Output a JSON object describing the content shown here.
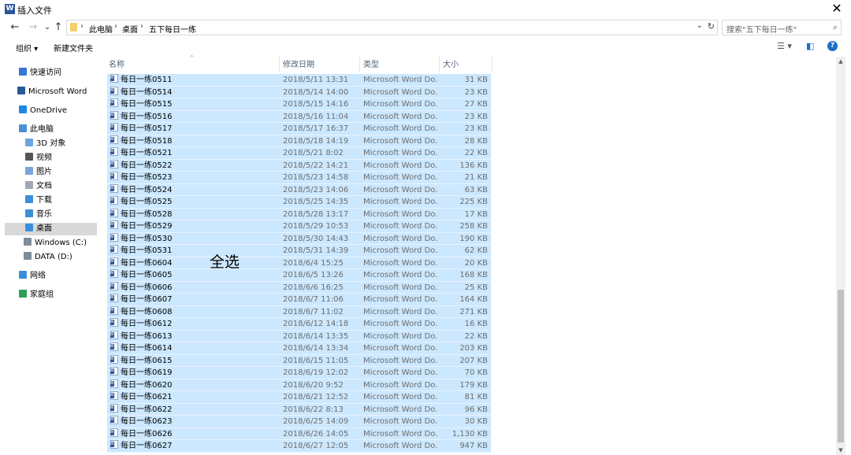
{
  "window": {
    "app_icon": "W",
    "title": "插入文件",
    "close_glyph": "✕"
  },
  "nav": {
    "back": "←",
    "forward": "→",
    "recent": "⌄",
    "up": "↑"
  },
  "address": {
    "breadcrumbs": [
      "此电脑",
      "桌面",
      "五下每日一练"
    ],
    "separator": "›",
    "dropdown": "⌄",
    "refresh": "↻"
  },
  "search": {
    "placeholder": "搜索\"五下每日一练\"",
    "icon": "⌕"
  },
  "toolbar": {
    "organize": "组织 ▾",
    "new_folder": "新建文件夹",
    "view_icon": "☰ ▾",
    "pane_icon": "◧",
    "help": "?"
  },
  "sidebar": {
    "items": [
      {
        "label": "快速访问",
        "icon": "star-icon",
        "color": "#3478d6"
      },
      {
        "label": "Microsoft Word",
        "icon": "word-icon",
        "color": "#2b579a"
      },
      {
        "label": "OneDrive",
        "icon": "cloud-icon",
        "color": "#1e88e5"
      },
      {
        "label": "此电脑",
        "icon": "computer-icon",
        "color": "#4a90d9"
      },
      {
        "label": "3D 对象",
        "icon": "cube-icon",
        "color": "#6aa5e0"
      },
      {
        "label": "视频",
        "icon": "video-icon",
        "color": "#555555"
      },
      {
        "label": "图片",
        "icon": "picture-icon",
        "color": "#7aa5d8"
      },
      {
        "label": "文档",
        "icon": "document-icon",
        "color": "#9fa8b3"
      },
      {
        "label": "下载",
        "icon": "download-icon",
        "color": "#3b8fd9"
      },
      {
        "label": "音乐",
        "icon": "music-icon",
        "color": "#3b8fd9"
      },
      {
        "label": "桌面",
        "icon": "desktop-icon",
        "color": "#3b8fd9",
        "selected": true
      },
      {
        "label": "Windows (C:)",
        "icon": "drive-c-icon",
        "color": "#7f8c99"
      },
      {
        "label": "DATA (D:)",
        "icon": "drive-d-icon",
        "color": "#7f8c99"
      },
      {
        "label": "网络",
        "icon": "network-icon",
        "color": "#3b8fd9"
      },
      {
        "label": "家庭组",
        "icon": "homegroup-icon",
        "color": "#2e9e5b"
      }
    ]
  },
  "columns": {
    "name": "名称",
    "date": "修改日期",
    "type": "类型",
    "size": "大小",
    "sort_glyph": "^"
  },
  "files": [
    {
      "name": "每日一练0511",
      "date": "2018/5/11 13:31",
      "type": "Microsoft Word Do...",
      "size": "31 KB"
    },
    {
      "name": "每日一练0514",
      "date": "2018/5/14 14:00",
      "type": "Microsoft Word Do...",
      "size": "23 KB"
    },
    {
      "name": "每日一练0515",
      "date": "2018/5/15 14:16",
      "type": "Microsoft Word Do...",
      "size": "27 KB"
    },
    {
      "name": "每日一练0516",
      "date": "2018/5/16 11:04",
      "type": "Microsoft Word Do...",
      "size": "23 KB"
    },
    {
      "name": "每日一练0517",
      "date": "2018/5/17 16:37",
      "type": "Microsoft Word Do...",
      "size": "23 KB"
    },
    {
      "name": "每日一练0518",
      "date": "2018/5/18 14:19",
      "type": "Microsoft Word Do...",
      "size": "28 KB"
    },
    {
      "name": "每日一练0521",
      "date": "2018/5/21 8:02",
      "type": "Microsoft Word Do...",
      "size": "22 KB"
    },
    {
      "name": "每日一练0522",
      "date": "2018/5/22 14:21",
      "type": "Microsoft Word Do...",
      "size": "136 KB"
    },
    {
      "name": "每日一练0523",
      "date": "2018/5/23 14:58",
      "type": "Microsoft Word Do...",
      "size": "21 KB"
    },
    {
      "name": "每日一练0524",
      "date": "2018/5/23 14:06",
      "type": "Microsoft Word Do...",
      "size": "63 KB"
    },
    {
      "name": "每日一练0525",
      "date": "2018/5/25 14:35",
      "type": "Microsoft Word Do...",
      "size": "225 KB"
    },
    {
      "name": "每日一练0528",
      "date": "2018/5/28 13:17",
      "type": "Microsoft Word Do...",
      "size": "17 KB"
    },
    {
      "name": "每日一练0529",
      "date": "2018/5/29 10:53",
      "type": "Microsoft Word Do...",
      "size": "258 KB"
    },
    {
      "name": "每日一练0530",
      "date": "2018/5/30 14:43",
      "type": "Microsoft Word Do...",
      "size": "190 KB"
    },
    {
      "name": "每日一练0531",
      "date": "2018/5/31 14:39",
      "type": "Microsoft Word Do...",
      "size": "62 KB"
    },
    {
      "name": "每日一练0604",
      "date": "2018/6/4 15:25",
      "type": "Microsoft Word Do...",
      "size": "20 KB"
    },
    {
      "name": "每日一练0605",
      "date": "2018/6/5 13:26",
      "type": "Microsoft Word Do...",
      "size": "168 KB"
    },
    {
      "name": "每日一练0606",
      "date": "2018/6/6 16:25",
      "type": "Microsoft Word Do...",
      "size": "25 KB"
    },
    {
      "name": "每日一练0607",
      "date": "2018/6/7 11:06",
      "type": "Microsoft Word Do...",
      "size": "164 KB"
    },
    {
      "name": "每日一练0608",
      "date": "2018/6/7 11:02",
      "type": "Microsoft Word Do...",
      "size": "271 KB"
    },
    {
      "name": "每日一练0612",
      "date": "2018/6/12 14:18",
      "type": "Microsoft Word Do...",
      "size": "16 KB"
    },
    {
      "name": "每日一练0613",
      "date": "2018/6/14 13:35",
      "type": "Microsoft Word Do...",
      "size": "22 KB"
    },
    {
      "name": "每日一练0614",
      "date": "2018/6/14 13:34",
      "type": "Microsoft Word Do...",
      "size": "203 KB"
    },
    {
      "name": "每日一练0615",
      "date": "2018/6/15 11:05",
      "type": "Microsoft Word Do...",
      "size": "207 KB"
    },
    {
      "name": "每日一练0619",
      "date": "2018/6/19 12:02",
      "type": "Microsoft Word Do...",
      "size": "70 KB"
    },
    {
      "name": "每日一练0620",
      "date": "2018/6/20 9:52",
      "type": "Microsoft Word Do...",
      "size": "179 KB"
    },
    {
      "name": "每日一练0621",
      "date": "2018/6/21 12:52",
      "type": "Microsoft Word Do...",
      "size": "81 KB"
    },
    {
      "name": "每日一练0622",
      "date": "2018/6/22 8:13",
      "type": "Microsoft Word Do...",
      "size": "96 KB"
    },
    {
      "name": "每日一练0623",
      "date": "2018/6/25 14:09",
      "type": "Microsoft Word Do...",
      "size": "30 KB"
    },
    {
      "name": "每日一练0626",
      "date": "2018/6/26 14:05",
      "type": "Microsoft Word Do...",
      "size": "1,130 KB"
    },
    {
      "name": "每日一练0627",
      "date": "2018/6/27 12:05",
      "type": "Microsoft Word Do...",
      "size": "947 KB"
    }
  ],
  "overlay": {
    "text": "全选"
  },
  "scrollbar": {
    "up": "▲",
    "down": "▼"
  },
  "colors": {
    "selection": "#cce8ff",
    "accent": "#1e6fc8",
    "sidebar_selected": "#d9d9d9"
  }
}
